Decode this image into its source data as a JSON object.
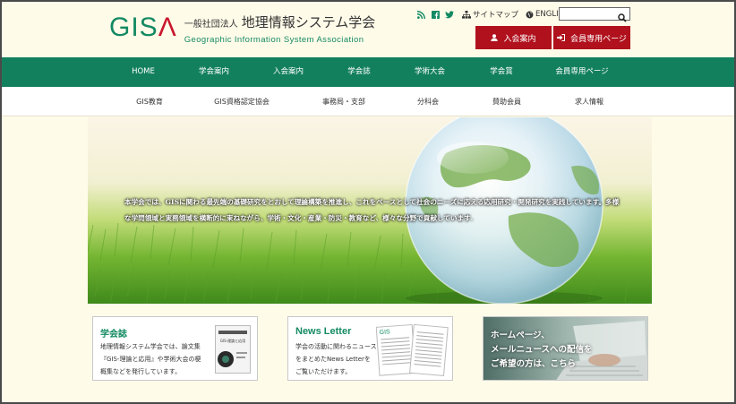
{
  "logo": {
    "mark_gis": "GIS",
    "mark_a": "Λ",
    "org_type": "一般社団法人",
    "name_jp": "地理情報システム学会",
    "name_en": "Geographic Information System Association"
  },
  "utility": {
    "sitemap_label": "サイトマップ",
    "english_label": "ENGLISH",
    "search_placeholder": ""
  },
  "buttons": {
    "join_label": "入会案内",
    "member_label": "会員専用ページ"
  },
  "main_nav": [
    "HOME",
    "学会案内",
    "入会案内",
    "学会誌",
    "学術大会",
    "学会賞",
    "会員専用ページ"
  ],
  "sub_nav": [
    "GIS教育",
    "GIS資格認定協会",
    "事務局・支部",
    "分科会",
    "賛助会員",
    "求人情報"
  ],
  "hero": {
    "line1": "本学会では、GISに関わる最先端の基礎研究をとおして理論構築を推進し、これをベースとして社会のニーズに応える応用研究・開発研究を実践しています。多様",
    "line2": "な学問領域と実務領域を横断的に束ねながら、学術・文化・産業・防災・教育など、様々な分野で貢献しています."
  },
  "cards": {
    "journal": {
      "title": "学会誌",
      "line1": "地理情報システム学会では、論文集",
      "line2": "『GIS-理論と応用』や学術大会の梗",
      "line3": "概集などを発行しています。",
      "thumb_label": "GIS-理論と応用"
    },
    "newsletter": {
      "title": "News Letter",
      "line1": "学会の活動に関わるニュース",
      "line2": "をまとめたNews Letterを",
      "line3": "ご覧いただけます。"
    },
    "mailnews": {
      "line1": "ホームページ、",
      "line2": "メールニュースへの配信を",
      "line3": "ご希望の方は、こちら"
    }
  },
  "colors": {
    "brand_green": "#13805d",
    "accent_red": "#b0111d",
    "background": "#fffbe9"
  }
}
